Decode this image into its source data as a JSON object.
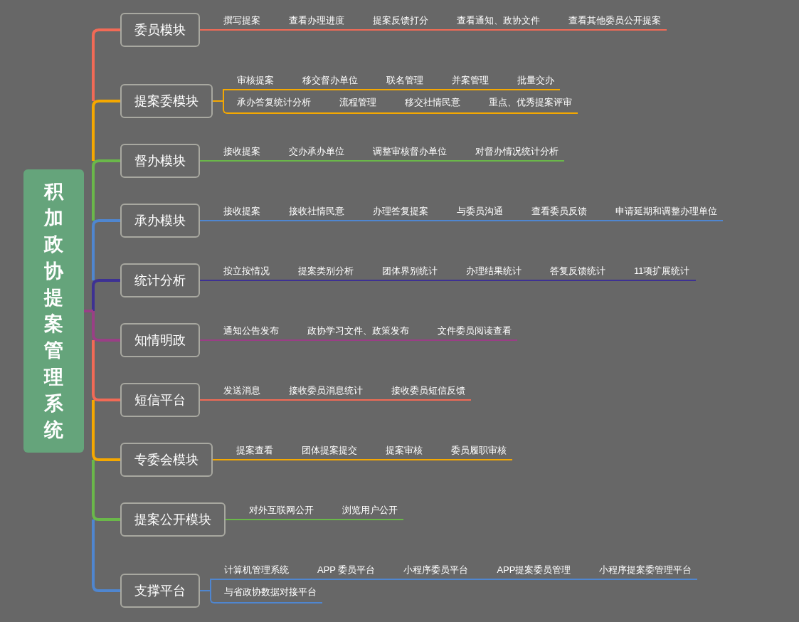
{
  "root": {
    "title": "积加政协提案管理系统"
  },
  "branches": [
    {
      "title": "委员模块",
      "color": "#f26a56",
      "lines": [
        {
          "topics": [
            "撰写提案",
            "查看办理进度",
            "提案反馈打分",
            "查看通知、政协文件",
            "查看其他委员公开提案"
          ]
        }
      ]
    },
    {
      "title": "提案委模块",
      "color": "#f5a800",
      "lines": [
        {
          "topics": [
            "审核提案",
            "移交督办单位",
            "联名管理",
            "并案管理",
            "批量交办"
          ]
        },
        {
          "topics": [
            "承办答复统计分析",
            "流程管理",
            "移交社情民意",
            "重点、优秀提案评审"
          ]
        }
      ]
    },
    {
      "title": "督办模块",
      "color": "#6ab84a",
      "lines": [
        {
          "topics": [
            "接收提案",
            "交办承办单位",
            "调整审核督办单位",
            "对督办情况统计分析"
          ]
        }
      ]
    },
    {
      "title": "承办模块",
      "color": "#4f86d0",
      "lines": [
        {
          "topics": [
            "接收提案",
            "接收社情民意",
            "办理答复提案",
            "与委员沟通",
            "查看委员反馈",
            "申请延期和调整办理单位"
          ]
        }
      ]
    },
    {
      "title": "统计分析",
      "color": "#3d3193",
      "lines": [
        {
          "topics": [
            "按立按情况",
            "提案类别分析",
            "团体界别统计",
            "办理结果统计",
            "答复反馈统计",
            "11项扩展统计"
          ]
        }
      ]
    },
    {
      "title": "知情明政",
      "color": "#9a3f86",
      "lines": [
        {
          "topics": [
            "通知公告发布",
            "政协学习文件、政策发布",
            "文件委员阅读查看"
          ]
        }
      ]
    },
    {
      "title": "短信平台",
      "color": "#f26a56",
      "lines": [
        {
          "topics": [
            "发送消息",
            "接收委员消息统计",
            "接收委员短信反馈"
          ]
        }
      ]
    },
    {
      "title": "专委会模块",
      "color": "#f5a800",
      "lines": [
        {
          "topics": [
            "提案查看",
            "团体提案提交",
            "提案审核",
            "委员履职审核"
          ]
        }
      ]
    },
    {
      "title": "提案公开模块",
      "color": "#6ab84a",
      "lines": [
        {
          "topics": [
            "对外互联网公开",
            "浏览用户公开"
          ]
        }
      ]
    },
    {
      "title": "支撑平台",
      "color": "#4f86d0",
      "lines": [
        {
          "topics": [
            "计算机管理系统",
            "APP 委员平台",
            "小程序委员平台",
            "APP提案委员管理",
            "小程序提案委管理平台"
          ]
        },
        {
          "topics": [
            "与省政协数据对接平台"
          ]
        }
      ]
    }
  ]
}
